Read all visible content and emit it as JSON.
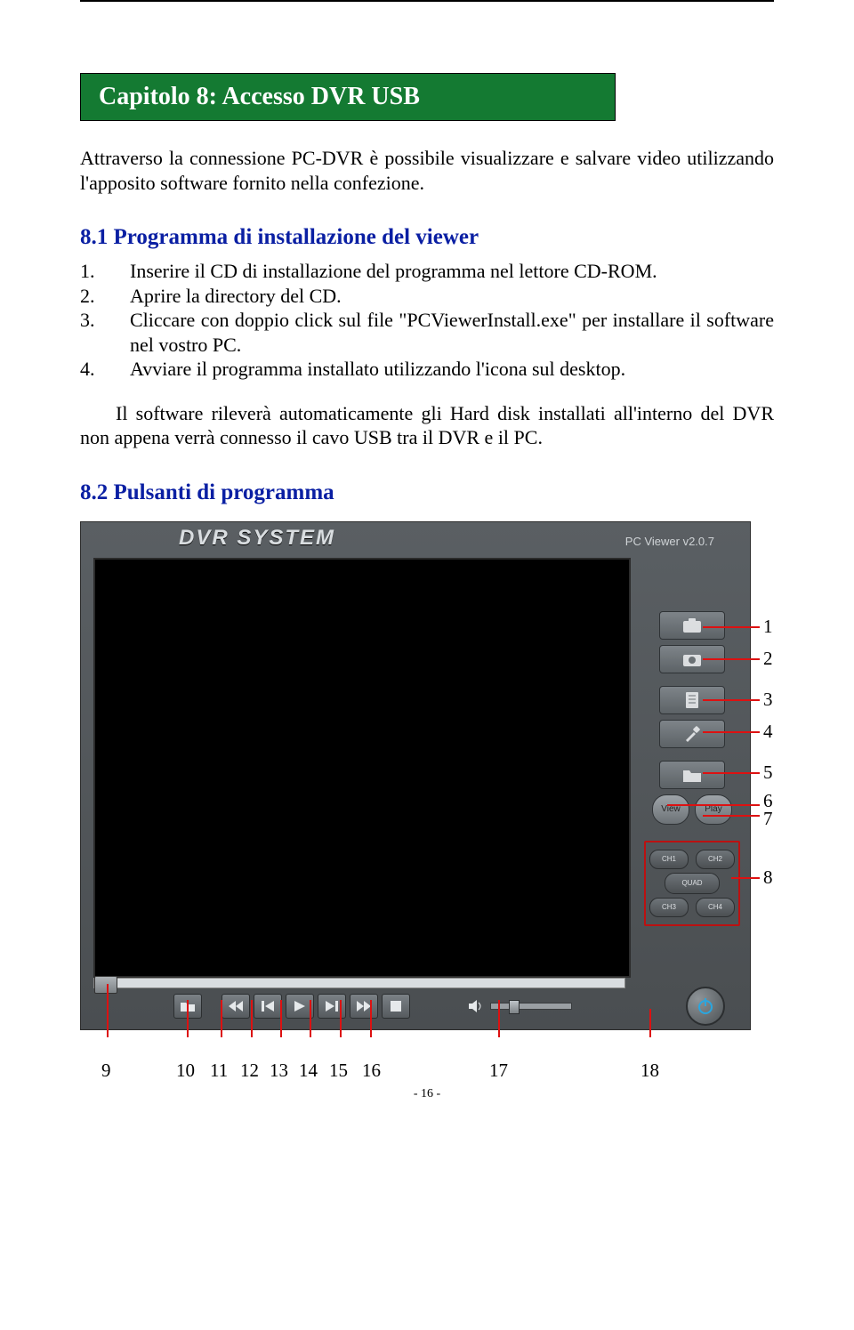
{
  "chapter_title": "Capitolo 8: Accesso DVR USB",
  "intro": "Attraverso la connessione PC-DVR è possibile visualizzare e salvare video utilizzando l'apposito software fornito nella confezione.",
  "section_8_1_title": "8.1 Programma di installazione del viewer",
  "steps": {
    "s1_num": "1.",
    "s1_txt": "Inserire il CD di installazione del programma nel lettore CD-ROM.",
    "s2_num": "2.",
    "s2_txt": "Aprire la directory del CD.",
    "s3_num": "3.",
    "s3_txt": "Cliccare con doppio click sul file \"PCViewerInstall.exe\" per installare il software nel vostro PC.",
    "s4_num": "4.",
    "s4_txt": "Avviare il programma installato utilizzando l'icona sul desktop."
  },
  "post_list": "Il software rileverà automaticamente gli Hard disk installati all'interno del DVR non appena verrà connesso il cavo USB tra il DVR e il PC.",
  "section_8_2_title": "8.2 Pulsanti di programma",
  "dvr": {
    "title": "DVR SYSTEM",
    "version": "PC Viewer v2.0.7",
    "view_label": "View",
    "play_label": "Play",
    "ch1": "CH1",
    "ch2": "CH2",
    "quad": "QUAD",
    "ch3": "CH3",
    "ch4": "CH4"
  },
  "side_callouts": {
    "c1": "1",
    "c2": "2",
    "c3": "3",
    "c4": "4",
    "c5": "5",
    "c6": "6",
    "c7": "7",
    "c8": "8"
  },
  "bottom_callouts": {
    "b9": "9",
    "b10": "10",
    "b11": "11",
    "b12": "12",
    "b13": "13",
    "b14": "14",
    "b15": "15",
    "b16": "16",
    "b17": "17",
    "b18": "18"
  },
  "page_number": "- 16 -"
}
